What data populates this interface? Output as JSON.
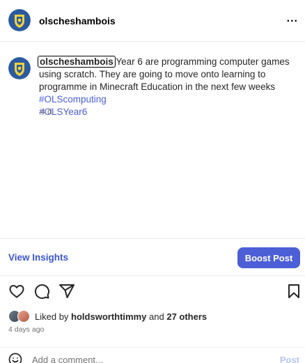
{
  "header": {
    "username": "olscheshambois",
    "more_icon": "more-horizontal-icon",
    "more_label": "..."
  },
  "post": {
    "caption_username": "olscheshambois",
    "caption_text": "Year 6 are programming computer games using scratch. They are going to move onto learning to programme in Minecraft Education in the next few weeks",
    "hashtags": [
      "#OLScomputing",
      "#OLSYear6"
    ],
    "time_ago": "4 d"
  },
  "insights": {
    "view_label": "View Insights",
    "boost_label": "Boost Post"
  },
  "actions": {
    "icons": [
      "heart-icon",
      "comment-icon",
      "share-icon",
      "bookmark-icon"
    ]
  },
  "likes": {
    "prefix": "Liked by",
    "user": "holdsworthtimmy",
    "joiner": "and",
    "others": "27 others"
  },
  "date": "4 days ago",
  "comment": {
    "placeholder": "Add a comment...",
    "post_label": "Post"
  },
  "colors": {
    "accent_blue": "#4c5fd7",
    "hashtag_blue": "#4a5edb",
    "avatar_shield_yellow": "#f4d23a",
    "avatar_shield_blue": "#2c5aa0"
  }
}
